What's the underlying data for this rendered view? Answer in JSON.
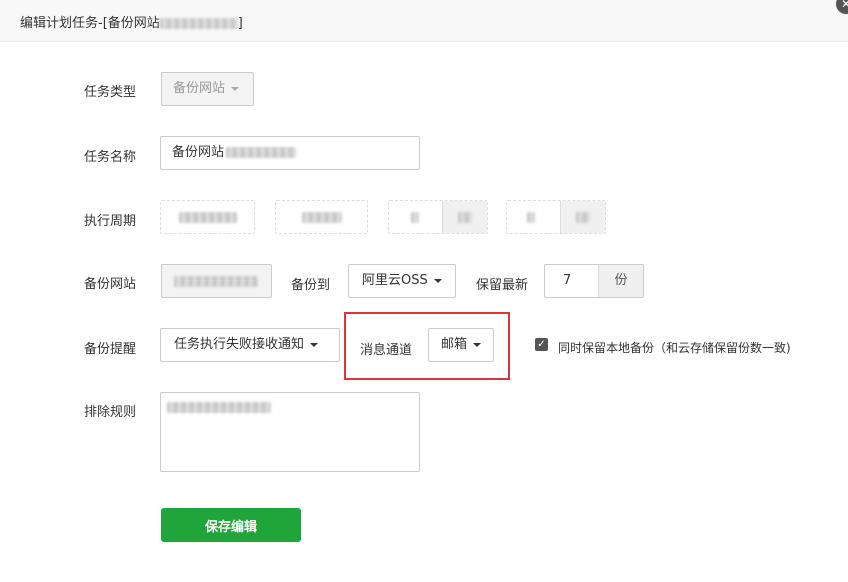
{
  "dialog": {
    "title_prefix": "编辑计划任务-[备份网站",
    "title_suffix": "]",
    "close_glyph": "✕"
  },
  "form": {
    "task_type": {
      "label": "任务类型",
      "value": "备份网站"
    },
    "task_name": {
      "label": "任务名称",
      "value": "备份网站"
    },
    "cycle": {
      "label": "执行周期"
    },
    "backup_site": {
      "label": "备份网站",
      "backup_to_label": "备份到",
      "backup_to_value": "阿里云OSS",
      "keep_latest_label": "保留最新",
      "keep_count": "7",
      "keep_unit": "份"
    },
    "reminder": {
      "label": "备份提醒",
      "value": "任务执行失败接收通知",
      "channel_label": "消息通道",
      "channel_value": "邮箱",
      "keep_local_label": "同时保留本地备份（和云存储保留份数一致)",
      "keep_local_checked": true,
      "check_glyph": "✓"
    },
    "exclude": {
      "label": "排除规则"
    },
    "save_label": "保存编辑"
  },
  "colors": {
    "save_button": "#20a53a",
    "highlight_outline": "#d9353e"
  }
}
